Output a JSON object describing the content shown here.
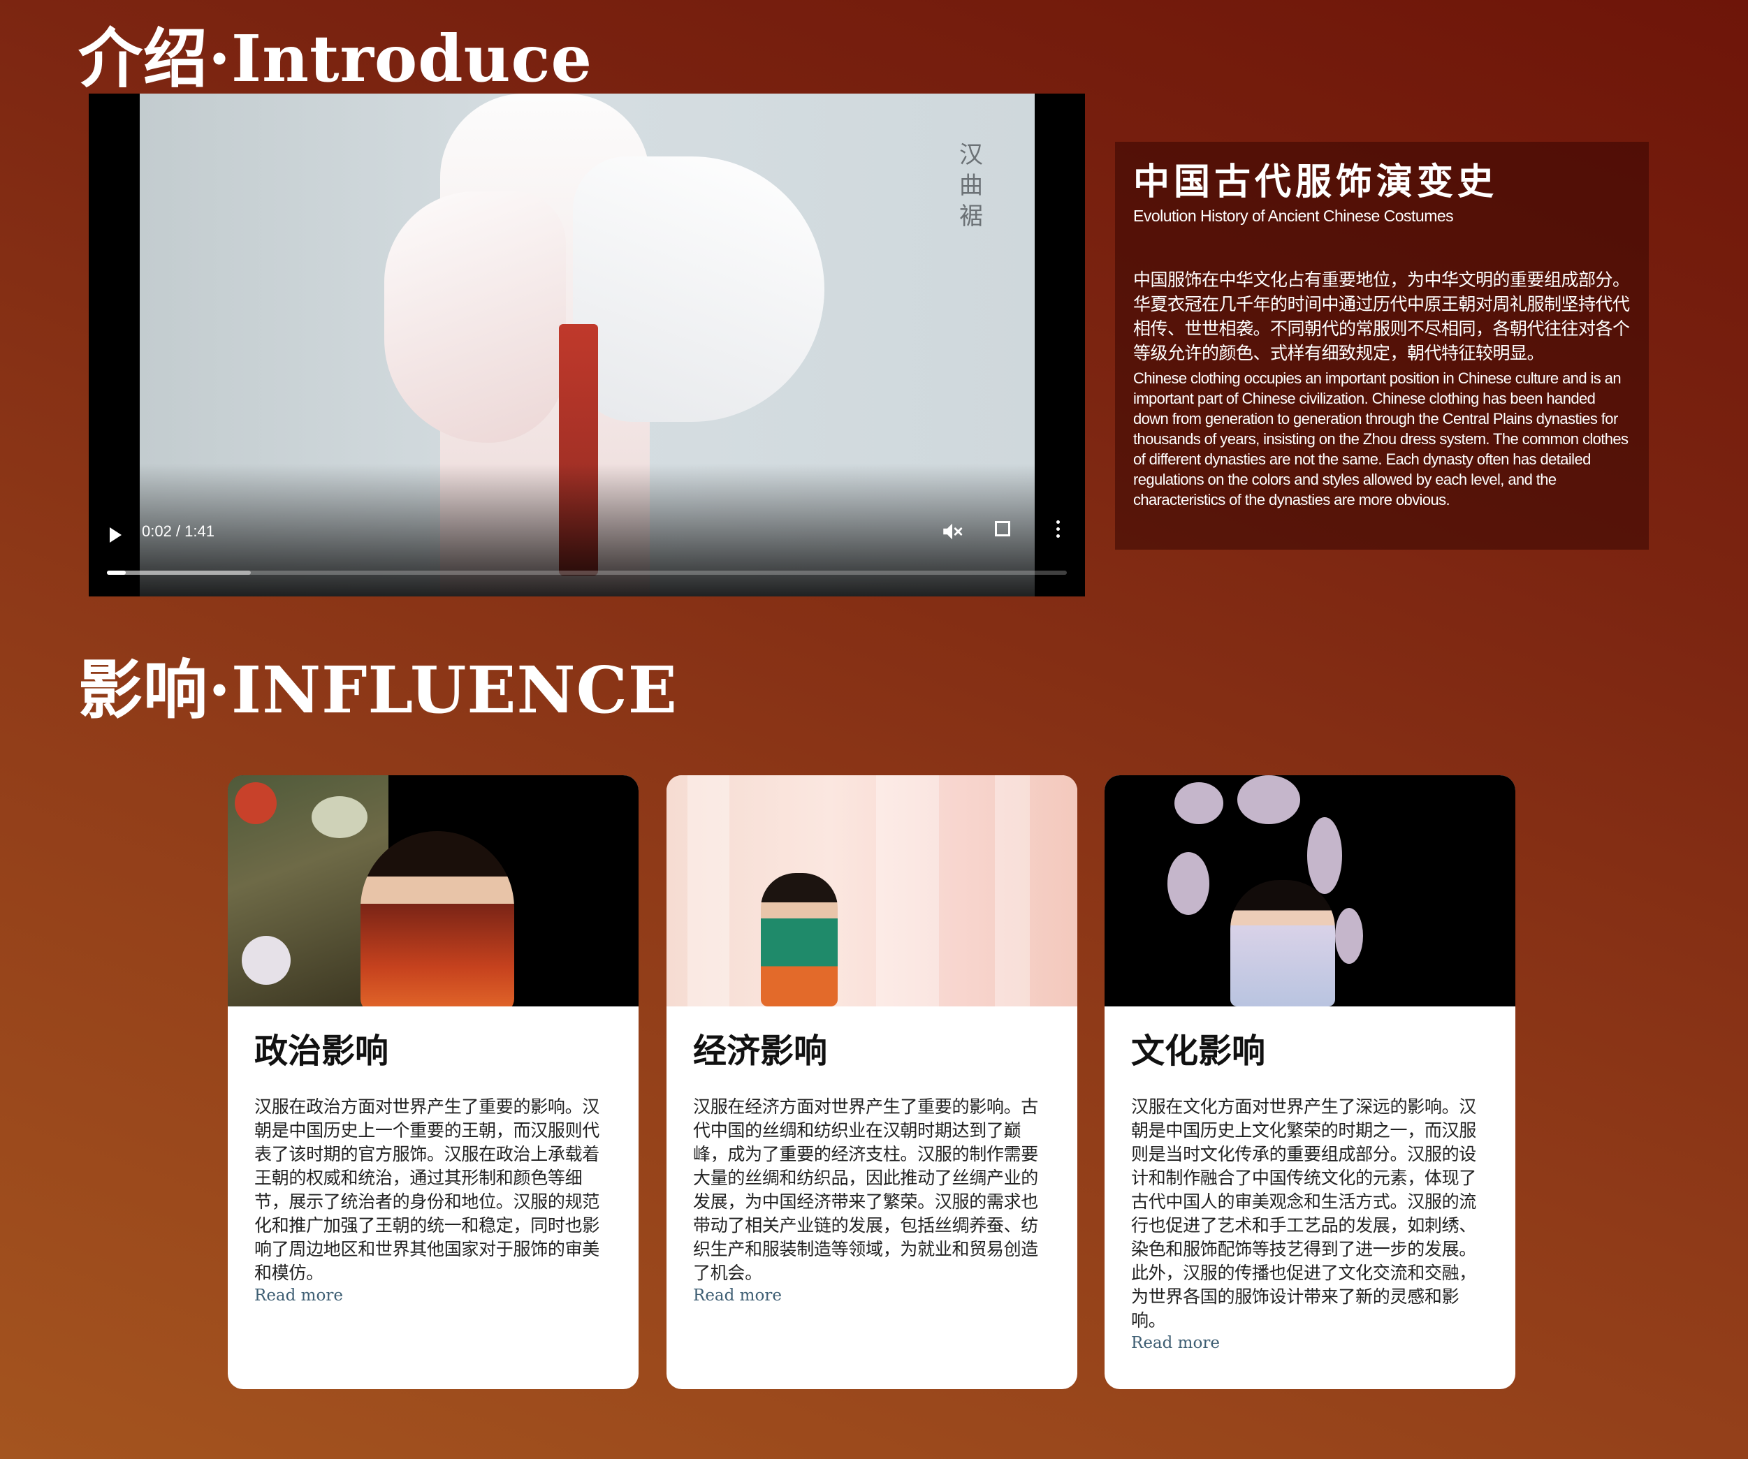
{
  "intro": {
    "heading": "介绍·Introduce",
    "video": {
      "overlay_text": "汉曲裾",
      "current_time": "0:02",
      "duration": "1:41",
      "time_display": "0:02 / 1:41",
      "progress_fraction": 0.02,
      "buffered_fraction": 0.15,
      "muted": true,
      "icons": {
        "play": "play-icon",
        "mute": "volume-muted-icon",
        "fullscreen": "fullscreen-icon",
        "menu": "more-vertical-icon"
      }
    },
    "box": {
      "title_cn": "中国古代服饰演变史",
      "title_en": "Evolution History of Ancient Chinese Costumes",
      "text_cn": "中国服饰在中华文化占有重要地位，为中华文明的重要组成部分。华夏衣冠在几千年的时间中通过历代中原王朝对周礼服制坚持代代相传、世世相袭。不同朝代的常服则不尽相同，各朝代往往对各个等级允许的颜色、式样有细致规定，朝代特征较明显。",
      "text_en": "Chinese clothing occupies an important position in Chinese culture and is an important part of Chinese civilization. Chinese clothing has been handed down from generation to generation through the Central Plains dynasties for thousands of years, insisting on the Zhou dress system. The common clothes of different dynasties are not the same. Each dynasty often has detailed regulations on the colors and styles allowed by each level, and the characteristics of the dynasties are more obvious."
    }
  },
  "influence": {
    "heading": "影响·INFLUENCE",
    "cards": [
      {
        "title": "政治影响",
        "text": "汉服在政治方面对世界产生了重要的影响。汉朝是中国历史上一个重要的王朝，而汉服则代表了该时期的官方服饰。汉服在政治上承载着王朝的权威和统治，通过其形制和颜色等细节，展示了统治者的身份和地位。汉服的规范化和推广加强了王朝的统一和稳定，同时也影响了周边地区和世界其他国家对于服饰的审美和模仿。",
        "link": "Read more"
      },
      {
        "title": "经济影响",
        "text": "汉服在经济方面对世界产生了重要的影响。古代中国的丝绸和纺织业在汉朝时期达到了巅峰，成为了重要的经济支柱。汉服的制作需要大量的丝绸和纺织品，因此推动了丝绸产业的发展，为中国经济带来了繁荣。汉服的需求也带动了相关产业链的发展，包括丝绸养蚕、纺织生产和服装制造等领域，为就业和贸易创造了机会。",
        "link": "Read more"
      },
      {
        "title": "文化影响",
        "text": "汉服在文化方面对世界产生了深远的影响。汉朝是中国历史上文化繁荣的时期之一，而汉服则是当时文化传承的重要组成部分。汉服的设计和制作融合了中国传统文化的元素，体现了古代中国人的审美观念和生活方式。汉服的流行也促进了艺术和手工艺品的发展，如刺绣、染色和服饰配饰等技艺得到了进一步的发展。此外，汉服的传播也促进了文化交流和交融，为世界各国的服饰设计带来了新的灵感和影响。",
        "link": "Read more"
      }
    ]
  },
  "colors": {
    "card_bg": "#ffffff",
    "link": "#3e5e73",
    "box_bg": "#3a0704"
  }
}
